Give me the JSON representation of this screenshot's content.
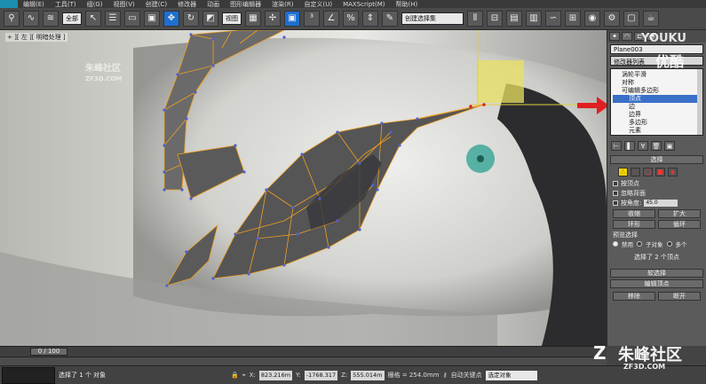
{
  "menubar": {
    "items": [
      "编辑(E)",
      "工具(T)",
      "组(G)",
      "视图(V)",
      "创建(C)",
      "修改器",
      "动画",
      "图形编辑器",
      "渲染(R)",
      "自定义(U)",
      "MAXScript(M)",
      "帮助(H)"
    ]
  },
  "toolbar": {
    "filter_select": "全部",
    "ref_coord_select": "视图",
    "named_selection": "创建选择集"
  },
  "viewport": {
    "label": "+ ][ 左 ][ 明暗处理 ]",
    "background_color": "#c9c9c4",
    "wire_color": "#f0a020",
    "vertex_color": "#5060d0",
    "arrow_color": "#e02020"
  },
  "command_panel": {
    "object_name": "Plane003",
    "modifier_list": "修改器列表",
    "stack": [
      {
        "label": "涡轮平滑",
        "level": 0,
        "selected": false
      },
      {
        "label": "对称",
        "level": 0,
        "selected": false
      },
      {
        "label": "可编辑多边形",
        "level": 0,
        "selected": false
      },
      {
        "label": "顶点",
        "level": 1,
        "selected": true
      },
      {
        "label": "边",
        "level": 1,
        "selected": false
      },
      {
        "label": "边界",
        "level": 1,
        "selected": false
      },
      {
        "label": "多边形",
        "level": 1,
        "selected": false
      },
      {
        "label": "元素",
        "level": 1,
        "selected": false
      }
    ],
    "selection_rollout": {
      "title": "选择",
      "by_vertex": "按顶点",
      "ignore_backfacing": "忽略背面",
      "by_angle": "按角度:",
      "angle_value": "45.0",
      "shrink": "收缩",
      "grow": "扩大",
      "ring": "环形",
      "loop": "循环",
      "preview_title": "预览选择",
      "preview_disabled": "禁用",
      "preview_subobject": "子对象",
      "preview_multi": "多个",
      "status": "选择了 2 个顶点"
    },
    "soft_selection_title": "软选择",
    "edit_vertices_title": "编辑顶点",
    "remove_button": "移除",
    "break_button": "断开"
  },
  "timeline": {
    "frame_label": "0 / 100"
  },
  "statusbar": {
    "selected_text": "选择了 1 个 对象",
    "x_label": "X:",
    "x_value": "823.216m",
    "y_label": "Y:",
    "y_value": "-1768.317",
    "z_label": "Z:",
    "z_value": "555.014m",
    "grid_text": "栅格 = 254.0mm",
    "auto_key": "自动关键点",
    "selection_dropdown": "选定对象"
  },
  "watermarks": {
    "youku_main": "YOUKU",
    "youku_cn": "优酷",
    "zf_top_main": "朱峰社区",
    "zf_top_sub": "ZF3D.COM",
    "zf_bottom_main": "朱峰社区",
    "zf_bottom_sub": "ZF3D.COM"
  }
}
